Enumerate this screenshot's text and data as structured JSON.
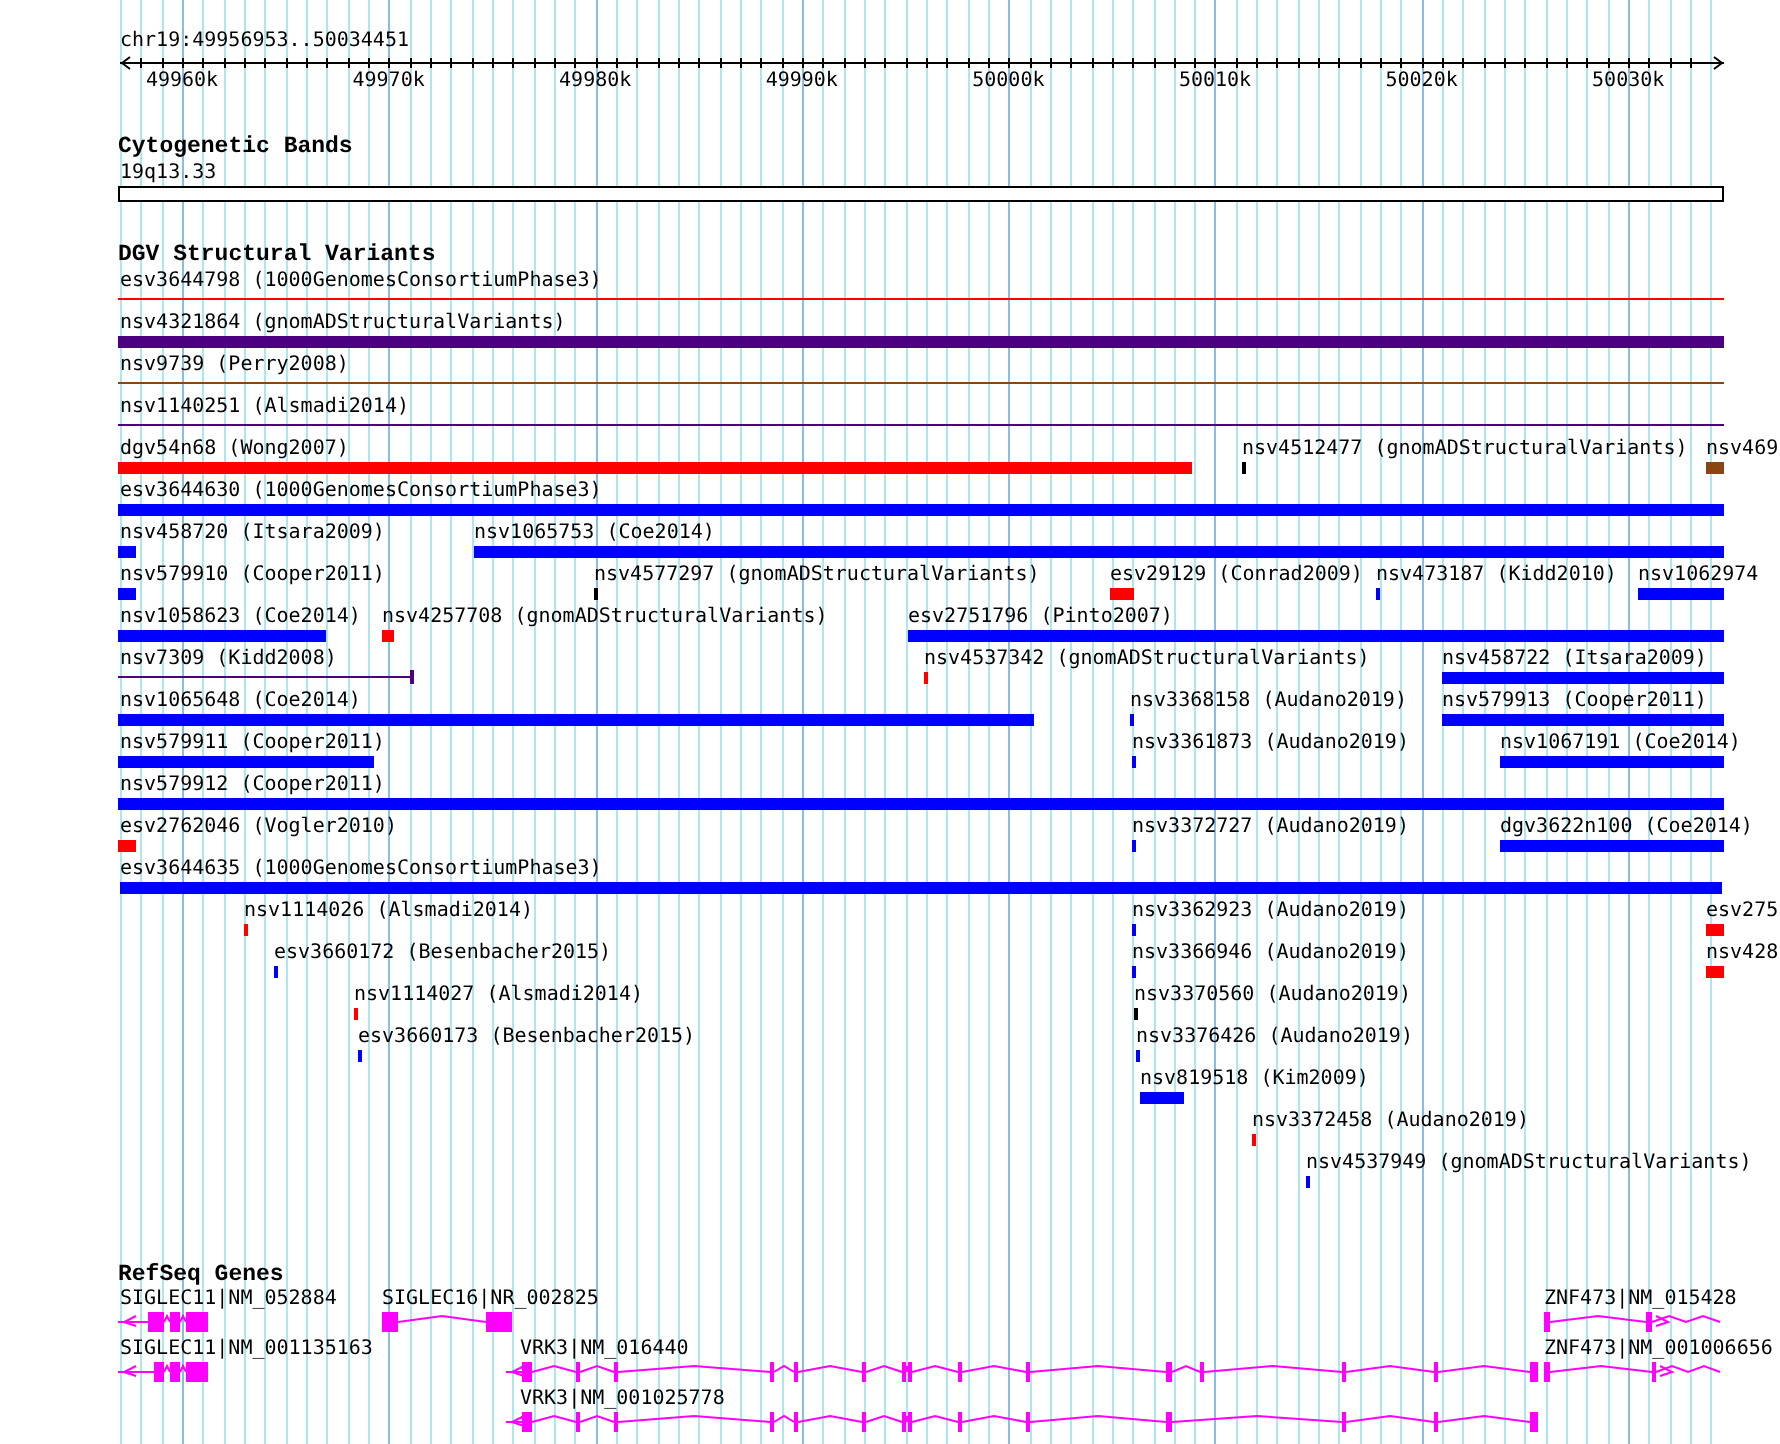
{
  "location": "chr19:49956953..50034451",
  "ruler": {
    "ticks": [
      "49960k",
      "49970k",
      "49980k",
      "49990k",
      "50000k",
      "50010k",
      "50020k",
      "50030k"
    ]
  },
  "cytogenetic_bands": {
    "title": "Cytogenetic Bands",
    "bands": [
      {
        "label": "19q13.33"
      }
    ]
  },
  "dgv_structural_variants": {
    "title": "DGV Structural Variants",
    "features": [
      {
        "label": "esv3644798 (1000GenomesConsortiumPhase3)",
        "kind": "line",
        "color": "#ff0000"
      },
      {
        "label": "nsv4321864 (gnomADStructuralVariants)",
        "kind": "bar",
        "color": "#4b0082"
      },
      {
        "label": "nsv9739 (Perry2008)",
        "kind": "line",
        "color": "#8b4513"
      },
      {
        "label": "nsv1140251 (Alsmadi2014)",
        "kind": "line",
        "color": "#4b0082"
      },
      {
        "label": "dgv54n68 (Wong2007)",
        "kind": "bar",
        "color": "#ff0000"
      },
      {
        "label": "nsv4512477 (gnomADStructuralVariants)",
        "kind": "bar",
        "color": "#000000"
      },
      {
        "label": "nsv469",
        "kind": "bar",
        "color": "#8b4513"
      },
      {
        "label": "esv3644630 (1000GenomesConsortiumPhase3)",
        "kind": "bar",
        "color": "#0000ff"
      },
      {
        "label": "nsv458720 (Itsara2009)",
        "kind": "bar",
        "color": "#0000ff"
      },
      {
        "label": "nsv1065753 (Coe2014)",
        "kind": "bar",
        "color": "#0000ff"
      },
      {
        "label": "nsv579910 (Cooper2011)",
        "kind": "bar",
        "color": "#0000ff"
      },
      {
        "label": "nsv4577297 (gnomADStructuralVariants)",
        "kind": "bar",
        "color": "#000000"
      },
      {
        "label": "esv29129 (Conrad2009)",
        "kind": "bar",
        "color": "#ff0000"
      },
      {
        "label": "nsv473187 (Kidd2010)",
        "kind": "bar",
        "color": "#0000ff"
      },
      {
        "label": "nsv1062974",
        "kind": "bar",
        "color": "#0000ff"
      },
      {
        "label": "nsv1058623 (Coe2014)",
        "kind": "bar",
        "color": "#0000ff"
      },
      {
        "label": "nsv4257708 (gnomADStructuralVariants)",
        "kind": "bar",
        "color": "#ff0000"
      },
      {
        "label": "esv2751796 (Pinto2007)",
        "kind": "bar",
        "color": "#0000ff"
      },
      {
        "label": "nsv7309 (Kidd2008)",
        "kind": "line",
        "color": "#4b0082"
      },
      {
        "label": "nsv4537342 (gnomADStructuralVariants)",
        "kind": "bar",
        "color": "#ff0000"
      },
      {
        "label": "nsv458722 (Itsara2009)",
        "kind": "bar",
        "color": "#0000ff"
      },
      {
        "label": "nsv1065648 (Coe2014)",
        "kind": "bar",
        "color": "#0000ff"
      },
      {
        "label": "nsv3368158 (Audano2019)",
        "kind": "bar",
        "color": "#0000ff"
      },
      {
        "label": "nsv579913 (Cooper2011)",
        "kind": "bar",
        "color": "#0000ff"
      },
      {
        "label": "nsv579911 (Cooper2011)",
        "kind": "bar",
        "color": "#0000ff"
      },
      {
        "label": "nsv3361873 (Audano2019)",
        "kind": "bar",
        "color": "#0000ff"
      },
      {
        "label": "nsv1067191 (Coe2014)",
        "kind": "bar",
        "color": "#0000ff"
      },
      {
        "label": "nsv579912 (Cooper2011)",
        "kind": "bar",
        "color": "#0000ff"
      },
      {
        "label": "esv2762046 (Vogler2010)",
        "kind": "bar",
        "color": "#ff0000"
      },
      {
        "label": "nsv3372727 (Audano2019)",
        "kind": "bar",
        "color": "#0000ff"
      },
      {
        "label": "dgv3622n100 (Coe2014)",
        "kind": "bar",
        "color": "#0000ff"
      },
      {
        "label": "esv3644635 (1000GenomesConsortiumPhase3)",
        "kind": "bar",
        "color": "#0000ff"
      },
      {
        "label": "nsv1114026 (Alsmadi2014)",
        "kind": "bar",
        "color": "#ff0000"
      },
      {
        "label": "nsv3362923 (Audano2019)",
        "kind": "bar",
        "color": "#0000ff"
      },
      {
        "label": "esv275",
        "kind": "bar",
        "color": "#ff0000"
      },
      {
        "label": "esv3660172 (Besenbacher2015)",
        "kind": "bar",
        "color": "#0000ff"
      },
      {
        "label": "nsv3366946 (Audano2019)",
        "kind": "bar",
        "color": "#0000ff"
      },
      {
        "label": "nsv428",
        "kind": "bar",
        "color": "#ff0000"
      },
      {
        "label": "nsv1114027 (Alsmadi2014)",
        "kind": "bar",
        "color": "#ff0000"
      },
      {
        "label": "nsv3370560 (Audano2019)",
        "kind": "bar",
        "color": "#000000"
      },
      {
        "label": "esv3660173 (Besenbacher2015)",
        "kind": "bar",
        "color": "#0000ff"
      },
      {
        "label": "nsv3376426 (Audano2019)",
        "kind": "bar",
        "color": "#0000ff"
      },
      {
        "label": "nsv819518 (Kim2009)",
        "kind": "bar",
        "color": "#0000ff"
      },
      {
        "label": "nsv3372458 (Audano2019)",
        "kind": "bar",
        "color": "#ff0000"
      },
      {
        "label": "nsv4537949 (gnomADStructuralVariants)",
        "kind": "bar",
        "color": "#0000ff"
      }
    ]
  },
  "refseq_genes": {
    "title": "RefSeq Genes",
    "genes": [
      {
        "label": "SIGLEC11|NM_052884"
      },
      {
        "label": "SIGLEC16|NR_002825"
      },
      {
        "label": "ZNF473|NM_015428"
      },
      {
        "label": "SIGLEC11|NM_001135163"
      },
      {
        "label": "VRK3|NM_016440"
      },
      {
        "label": "ZNF473|NM_001006656"
      },
      {
        "label": "VRK3|NM_001025778"
      }
    ]
  }
}
